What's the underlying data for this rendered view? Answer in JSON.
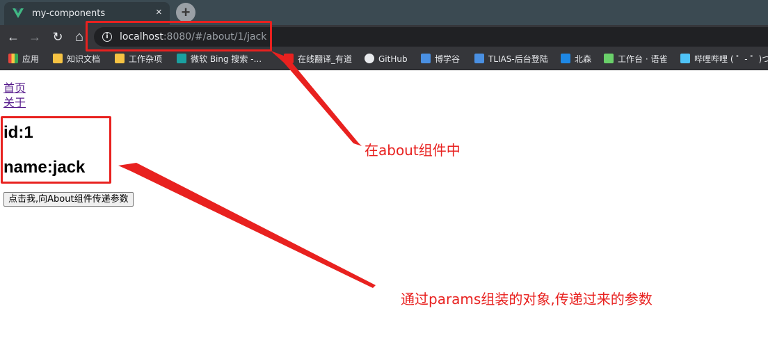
{
  "browser": {
    "tab": {
      "title": "my-components",
      "close": "×",
      "favicon": "vue-logo-icon"
    },
    "new_tab": "+",
    "nav": {
      "back": "←",
      "forward": "→",
      "reload": "↻",
      "home": "⌂"
    },
    "address": {
      "host": "localhost",
      "rest": ":8080/#/about/1/jack"
    },
    "bookmarks": [
      {
        "label": "应用",
        "color": "#e8453c"
      },
      {
        "label": "知识文档",
        "color": "#f6c343"
      },
      {
        "label": "工作杂项",
        "color": "#f6c343"
      },
      {
        "label": "微软 Bing 搜索 -...",
        "color": "#1aa0a0"
      },
      {
        "label": "在线翻译_有道",
        "color": "#e8211f"
      },
      {
        "label": "GitHub",
        "color": "#e8eaed"
      },
      {
        "label": "博学谷",
        "color": "#4a90e2"
      },
      {
        "label": "TLIAS-后台登陆",
        "color": "#4a90e2"
      },
      {
        "label": "北森",
        "color": "#1e88e5"
      },
      {
        "label": "工作台 · 语雀",
        "color": "#6ad06a"
      },
      {
        "label": "哔哩哔哩 ( ゜- ゜)つ...",
        "color": "#4fc3f7"
      }
    ]
  },
  "page": {
    "links": {
      "home": "首页",
      "about": "关于"
    },
    "id_text": "id:1",
    "name_text": "name:jack",
    "button_label": "点击我,向About组件传递参数"
  },
  "annotations": {
    "about_note": "在about组件中",
    "params_note": "通过params组装的对象,传递过来的参数",
    "color": "#e8211f"
  }
}
